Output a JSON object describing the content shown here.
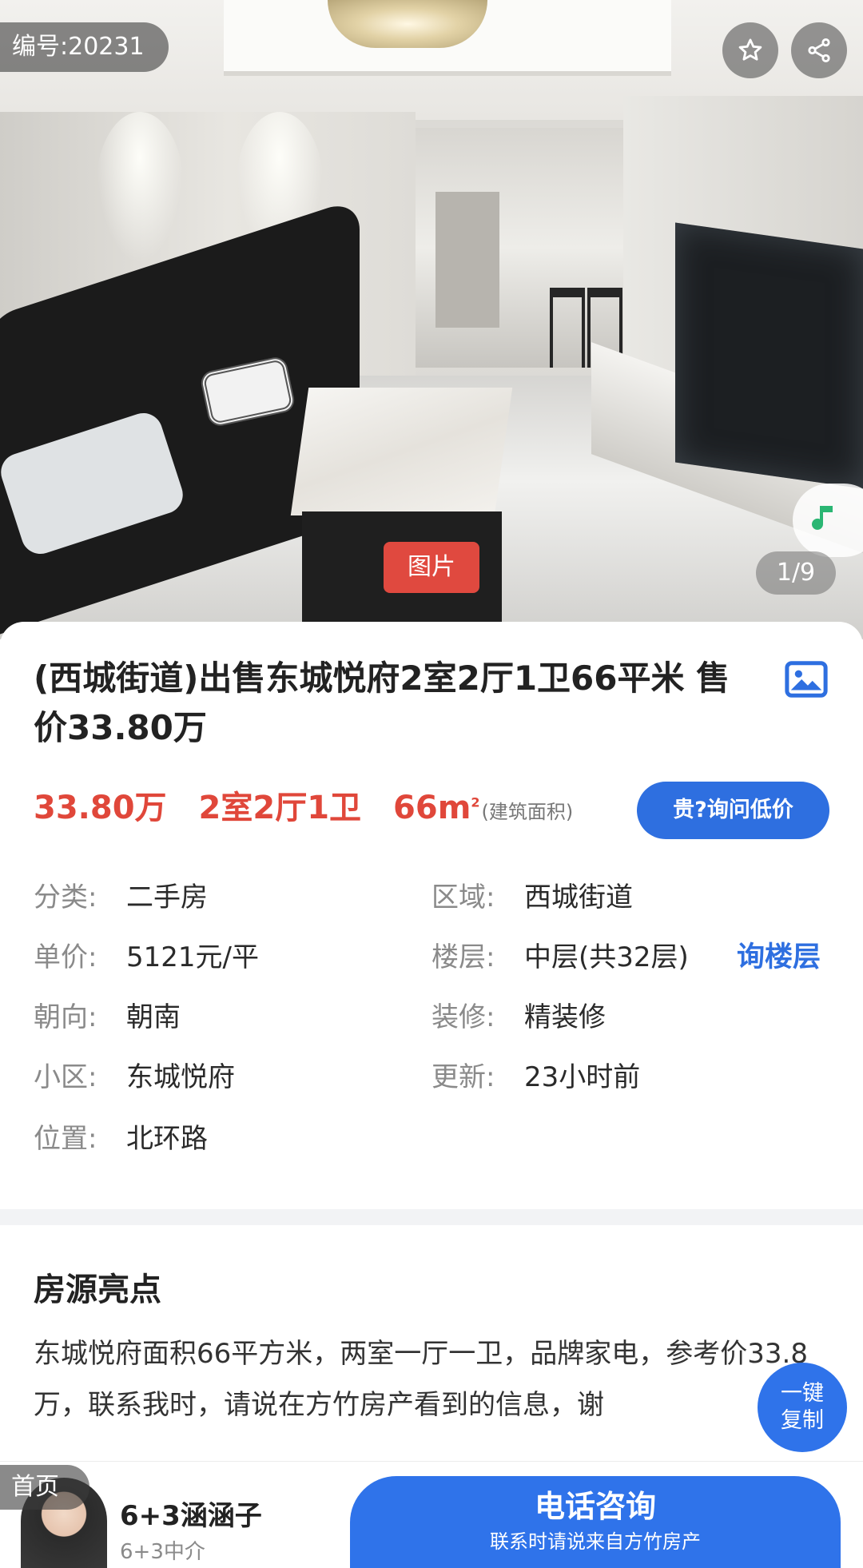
{
  "hero": {
    "id_label": "编号:20231",
    "counter": "1/9",
    "pic_tag": "图片",
    "icons": [
      "star-icon",
      "share-icon",
      "music-note-icon"
    ]
  },
  "listing": {
    "title": "(西城街道)出售东城悦府2室2厅1卫66平米 售价33.80万",
    "price": "33.80万",
    "layout": "2室2厅1卫",
    "area": "66m",
    "area_sup": "2",
    "area_note": "(建筑面积)",
    "ask_button": "贵?询问低价",
    "ask_floor": "询楼层",
    "attributes_left": [
      {
        "key": "分类:",
        "value": "二手房"
      },
      {
        "key": "单价:",
        "value": "5121元/平"
      },
      {
        "key": "朝向:",
        "value": "朝南"
      },
      {
        "key": "小区:",
        "value": "东城悦府"
      },
      {
        "key": "位置:",
        "value": "北环路"
      }
    ],
    "attributes_right": [
      {
        "key": "区域:",
        "value": "西城街道"
      },
      {
        "key": "楼层:",
        "value": "中层(共32层)"
      },
      {
        "key": "装修:",
        "value": "精装修"
      },
      {
        "key": "更新:",
        "value": "23小时前"
      }
    ]
  },
  "highlights": {
    "title": "房源亮点",
    "text": "东城悦府面积66平方米，两室一厅一卫，品牌家电，参考价33.8万，联系我时，请说在方竹房产看到的信息，谢"
  },
  "copy_button": {
    "line1": "一键",
    "line2": "复制"
  },
  "bottom": {
    "home_label": "首页",
    "agent_name": "6+3涵涵子",
    "agent_company": "6+3中介",
    "call_main": "电话咨询",
    "call_sub": "联系时请说来自方竹房产"
  },
  "colors": {
    "accent_blue": "#2f73ea",
    "price_red": "#e0473a",
    "tag_red": "#e0493f"
  }
}
